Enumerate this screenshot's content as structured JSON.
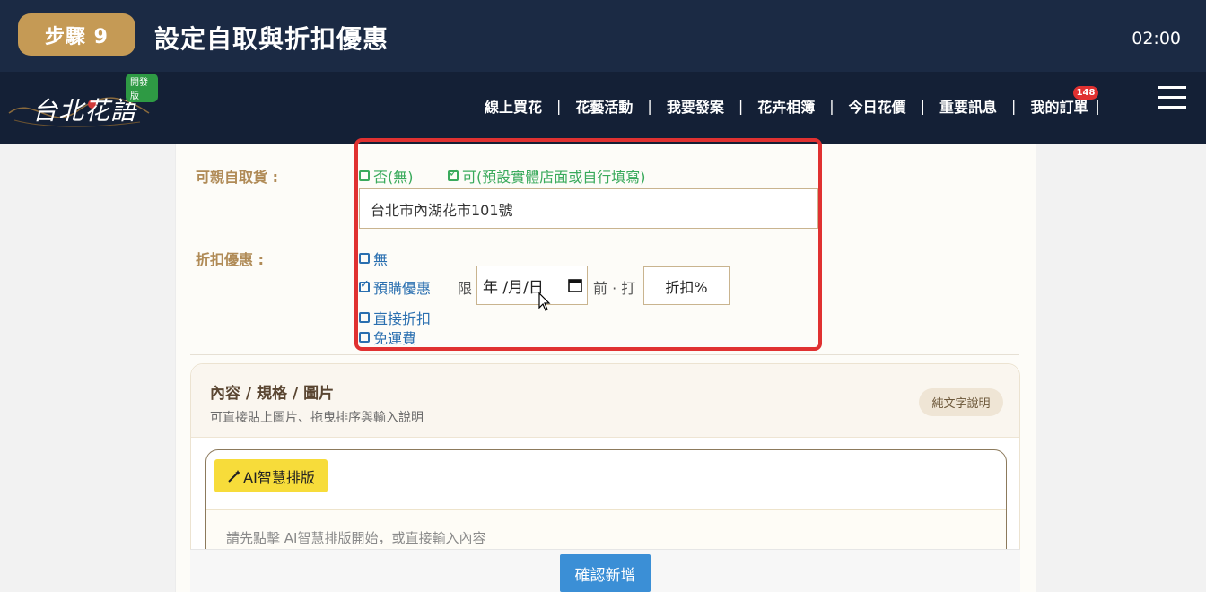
{
  "step": {
    "badge": "步驟 9",
    "title": "設定自取與折扣優惠",
    "time": "02:00"
  },
  "site": {
    "logo_text": "台北花語",
    "dev_badge": "開發版",
    "nav": [
      "線上買花",
      "花藝活動",
      "我要發案",
      "花卉相簿",
      "今日花價",
      "重要訊息",
      "我的訂單"
    ],
    "orders_badge": "148",
    "separator": "|"
  },
  "pickup": {
    "label": "可親自取貨 :",
    "option_no": "否(無)",
    "option_yes": "可(預設實體店面或自行填寫)",
    "selected": "yes",
    "address": "台北市內湖花市101號"
  },
  "discount": {
    "label": "折扣優惠 :",
    "options": {
      "none": "無",
      "preorder": "預購優惠",
      "direct": "直接折扣",
      "free_shipping": "免運費"
    },
    "selected": "preorder",
    "limit_prefix": "限",
    "date_placeholder": "年 /月/日",
    "before_text": "前 · 打",
    "percent_placeholder": "折扣%"
  },
  "content_section": {
    "title": "內容 / 規格 / 圖片",
    "subtitle": "可直接貼上圖片、拖曳排序與輸入說明",
    "text_desc_button": "純文字說明",
    "ai_button": "AI智慧排版",
    "editor_placeholder": "請先點擊 AI智慧排版開始，或直接輸入內容"
  },
  "confirm_button": "確認新增",
  "colors": {
    "step_bar": "#1b2a44",
    "nav_bar": "#142036",
    "badge_gold": "#c59a55",
    "pickup_green": "#3aaa5c",
    "discount_blue": "#2a6fb0",
    "highlight_red": "#e03131",
    "ai_yellow": "#f7dc3a",
    "confirm_blue": "#3b8fd6"
  },
  "icons": {
    "calendar": "calendar-icon",
    "magic": "magic-wand-icon",
    "menu": "hamburger-menu-icon",
    "cursor": "mouse-cursor-icon"
  }
}
